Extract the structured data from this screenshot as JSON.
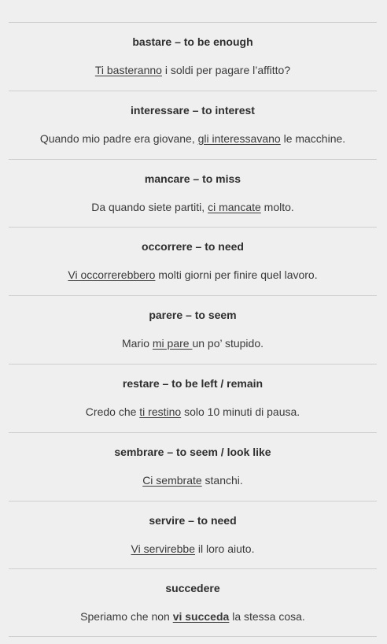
{
  "entries": [
    {
      "term": "bastare – to be enough",
      "before": "",
      "highlight": "Ti basteranno",
      "after": " i soldi per pagare l’affitto?",
      "highlight_bold": false
    },
    {
      "term": "interessare – to interest",
      "before": "Quando mio padre era giovane, ",
      "highlight": "gli interessavano",
      "after": " le macchine.",
      "highlight_bold": false
    },
    {
      "term": "mancare – to miss",
      "before": "Da quando siete partiti, ",
      "highlight": "ci mancate",
      "after": " molto.",
      "highlight_bold": false
    },
    {
      "term": "occorrere – to need",
      "before": "",
      "highlight": "Vi occorrerebbero",
      "after": " molti giorni per finire quel lavoro.",
      "highlight_bold": false
    },
    {
      "term": "parere – to seem",
      "before": "Mario ",
      "highlight": "mi pare ",
      "after": "un po’ stupido.",
      "highlight_bold": false
    },
    {
      "term": "restare – to be left / remain",
      "before": "Credo che ",
      "highlight": "ti restino",
      "after": " solo 10 minuti di pausa.",
      "highlight_bold": false
    },
    {
      "term": "sembrare – to seem / look like",
      "before": "",
      "highlight": "Ci sembrate",
      "after": " stanchi.",
      "highlight_bold": false
    },
    {
      "term": "servire – to need",
      "before": "",
      "highlight": "Vi servirebbe",
      "after": " il loro aiuto.",
      "highlight_bold": false
    },
    {
      "term": "succedere",
      "before": "Speriamo che non ",
      "highlight": "vi succeda",
      "after": " la stessa cosa.",
      "highlight_bold": true
    }
  ]
}
